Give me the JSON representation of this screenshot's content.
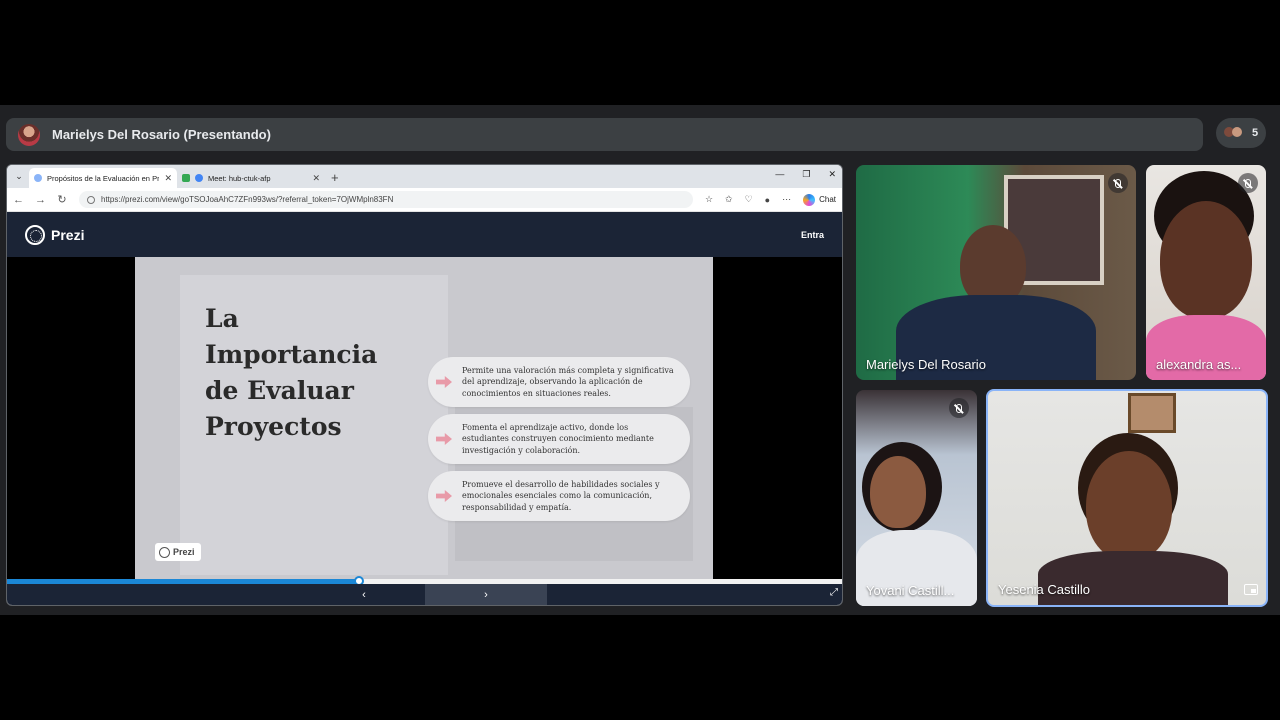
{
  "presenter": {
    "name": "Marielys Del Rosario (Presentando)"
  },
  "participants_count": "5",
  "browser": {
    "tabs": [
      {
        "title": "Propósitos de la Evaluación en Pro"
      },
      {
        "title": "Meet: hub-ctuk-afp"
      }
    ],
    "url": "https://prezi.com/view/goTSOJoaAhC7ZFn993ws/?referral_token=7OjWMpln83FN",
    "chat_label": "Chat"
  },
  "prezi": {
    "logo_text": "Prezi",
    "entra_label": "Entra",
    "slide": {
      "title_lines": [
        "La",
        "Importancia",
        "de Evaluar",
        "Proyectos"
      ],
      "points": [
        "Permite una valoración más completa y significativa del aprendizaje, observando la aplicación de conocimientos en situaciones reales.",
        "Fomenta el aprendizaje activo, donde los estudiantes construyen conocimiento mediante investigación y colaboración.",
        "Promueve el desarrollo de habilidades sociales y emocionales esenciales como la comunicación, responsabilidad y empatía."
      ],
      "badge": "Prezi"
    },
    "progress_fraction": 0.42
  },
  "tiles": [
    {
      "name": "Marielys Del Rosario",
      "muted": true
    },
    {
      "name": "alexandra as...",
      "muted": true
    },
    {
      "name": "Yovani Castill...",
      "muted": true
    },
    {
      "name": "Yesenia Castillo",
      "muted": false
    }
  ]
}
